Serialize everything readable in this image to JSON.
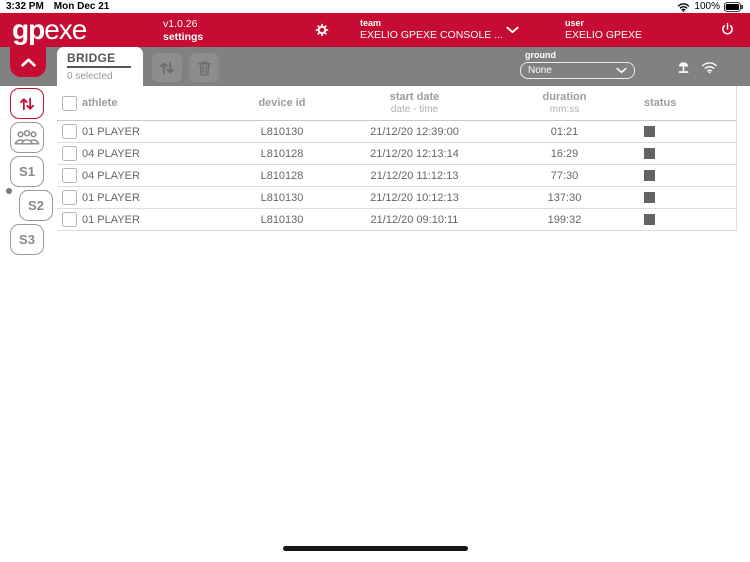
{
  "status_bar": {
    "time": "3:32 PM",
    "date": "Mon Dec 21",
    "battery_percent": "100%"
  },
  "header": {
    "logo_bold": "gp",
    "logo_light": "exe",
    "version": "v1.0.26",
    "settings_label": "settings",
    "team_label": "team",
    "team_value": "EXELIO GPEXE CONSOLE ...",
    "user_label": "user",
    "user_value": "EXELIO GPEXE"
  },
  "toolbar": {
    "tab_title": "BRIDGE",
    "tab_subtitle": "0 selected",
    "ground_label": "ground",
    "ground_value": "None"
  },
  "sidebar": {
    "session_buttons": [
      "S1",
      "S2",
      "S3"
    ]
  },
  "table": {
    "columns": {
      "athlete": "athlete",
      "device_id": "device id",
      "start_date": "start date",
      "start_date_sub": "date - time",
      "duration": "duration",
      "duration_sub": "mm:ss",
      "status": "status"
    },
    "rows": [
      {
        "athlete": "01 PLAYER",
        "device_id": "L810130",
        "start_date": "21/12/20 12:39:00",
        "duration": "01:21"
      },
      {
        "athlete": "04 PLAYER",
        "device_id": "L810128",
        "start_date": "21/12/20 12:13:14",
        "duration": "16:29"
      },
      {
        "athlete": "04 PLAYER",
        "device_id": "L810128",
        "start_date": "21/12/20 11:12:13",
        "duration": "77:30"
      },
      {
        "athlete": "01 PLAYER",
        "device_id": "L810130",
        "start_date": "21/12/20 10:12:13",
        "duration": "137:30"
      },
      {
        "athlete": "01 PLAYER",
        "device_id": "L810130",
        "start_date": "21/12/20 09:10:11",
        "duration": "199:32"
      }
    ]
  },
  "colors": {
    "brand_red": "#C60C32",
    "toolbar_gray": "#818181",
    "status_square_gray": "#636363"
  }
}
